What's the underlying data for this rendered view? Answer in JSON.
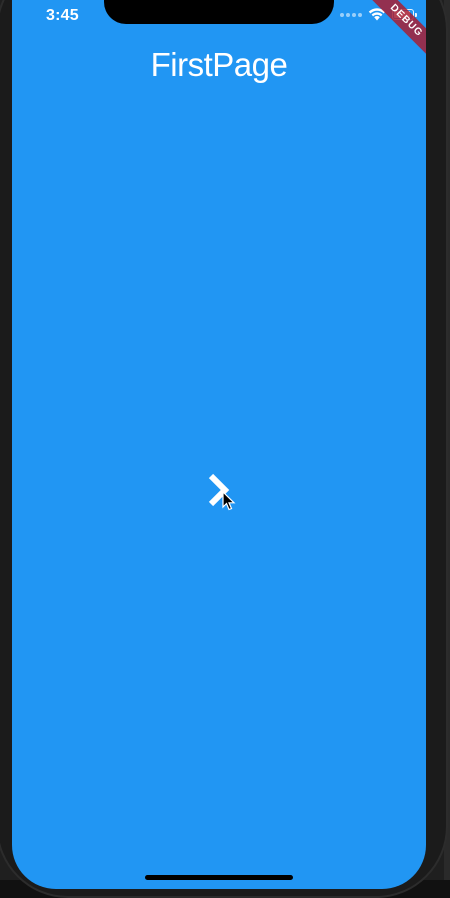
{
  "status_bar": {
    "time": "3:45",
    "icons": [
      "signal-dots-icon",
      "wifi-icon",
      "battery-icon"
    ]
  },
  "debug_banner": {
    "label": "DEBUG"
  },
  "app_bar": {
    "title": "FirstPage"
  },
  "main": {
    "next_button_icon": "chevron-right-icon"
  },
  "colors": {
    "background": "#2196f3",
    "text": "#ffffff",
    "debug_banner": "#a71e32"
  }
}
